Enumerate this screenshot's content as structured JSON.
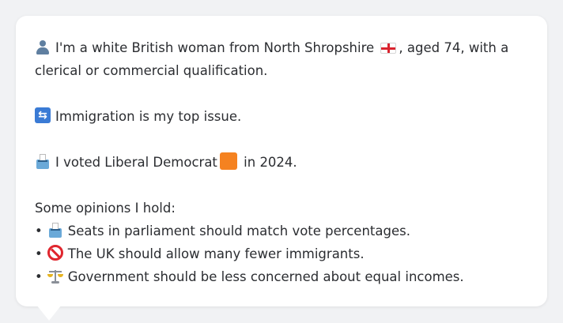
{
  "profile": {
    "identity_text_a": "I'm a white British woman from North Shropshire",
    "identity_text_b": ", aged 74, with a clerical or commercial qualification.",
    "identity_icon": "person-icon",
    "region_flag_icon": "england-flag-icon",
    "top_issue_icon": "immigration-icon",
    "top_issue_text": "Immigration is my top issue.",
    "vote_icon": "ballot-box-icon",
    "vote_text_a": "I voted Liberal Democrat",
    "vote_party_icon": "orange-square-icon",
    "vote_text_b": " in 2024.",
    "party_color": "#f58220"
  },
  "opinions": {
    "heading": "Some opinions I hold:",
    "bullet": "•",
    "items": [
      {
        "icon": "ballot-box-icon",
        "text": "Seats in parliament should match vote percentages."
      },
      {
        "icon": "prohibited-icon",
        "text": "The UK should allow many fewer immigrants."
      },
      {
        "icon": "scales-icon",
        "text": "Government should be less concerned about equal incomes."
      }
    ]
  }
}
